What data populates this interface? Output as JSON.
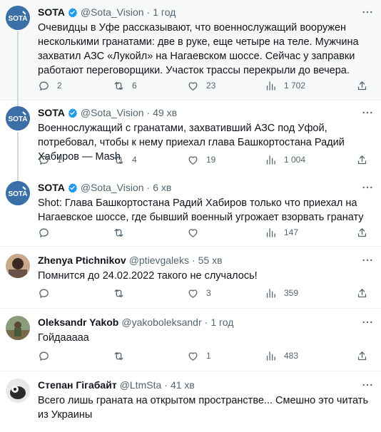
{
  "tweets": [
    {
      "name": "SOTA",
      "handle": "@Sota_Vision",
      "sep": "·",
      "time": "1 год",
      "text": "Очевидцы в Уфе рассказывают, что военнослужащий вооружен несколькими гранатами: две в руке, еще четыре на теле. Мужчина захватил АЗС «Лукойл» на Нагаевском шоссе. Сейчас у заправки работают переговорщики. Участок трассы перекрыли до вечера.",
      "replies": "2",
      "retweets": "6",
      "likes": "23",
      "views": "1 702"
    },
    {
      "name": "SOTA",
      "handle": "@Sota_Vision",
      "sep": "·",
      "time": "49 хв",
      "text": "Военнослужащий с гранатами, захвативший АЗС под Уфой, потребовал, чтобы к нему приехал глава Башкортостана Радий Хабиров — Mash",
      "replies": "1",
      "retweets": "4",
      "likes": "19",
      "views": "1 004"
    },
    {
      "name": "SOTA",
      "handle": "@Sota_Vision",
      "sep": "·",
      "time": "6 хв",
      "text": "Shot: Глава Башкортостана Радий Хабиров только что приехал на Нагаевское шоссе, где бывший военный угрожает взорвать гранату",
      "replies": "",
      "retweets": "",
      "likes": "",
      "views": "147"
    },
    {
      "name": "Zhenya Ptichnikov",
      "handle": "@ptievgaleks",
      "sep": "·",
      "time": "55 хв",
      "text": "Помнится до 24.02.2022 такого не случалось!",
      "replies": "",
      "retweets": "",
      "likes": "3",
      "views": "359"
    },
    {
      "name": "Oleksandr Yakob",
      "handle": "@yakoboleksandr",
      "sep": "·",
      "time": "1 год",
      "text": "Гойдааааа",
      "replies": "",
      "retweets": "",
      "likes": "1",
      "views": "483"
    },
    {
      "name": "Степан Гігабайт",
      "handle": "@LtmSta",
      "sep": "·",
      "time": "41 хв",
      "text": "Всего лишь граната на открытом пространстве... Смешно это читать из Украины",
      "replies": "",
      "retweets": "",
      "likes": "",
      "views": ""
    }
  ],
  "colors": {
    "text": "#0f1419",
    "secondary": "#536471",
    "verified": "#1d9bf0",
    "sota_avatar": "#3a6fa8",
    "highlight_bg": "#f7f9f9"
  },
  "icons": {
    "verified": "verified-badge-icon",
    "more": "more-dots-icon",
    "reply": "reply-icon",
    "retweet": "retweet-icon",
    "like": "heart-icon",
    "views": "views-bars-icon",
    "share": "share-icon"
  }
}
